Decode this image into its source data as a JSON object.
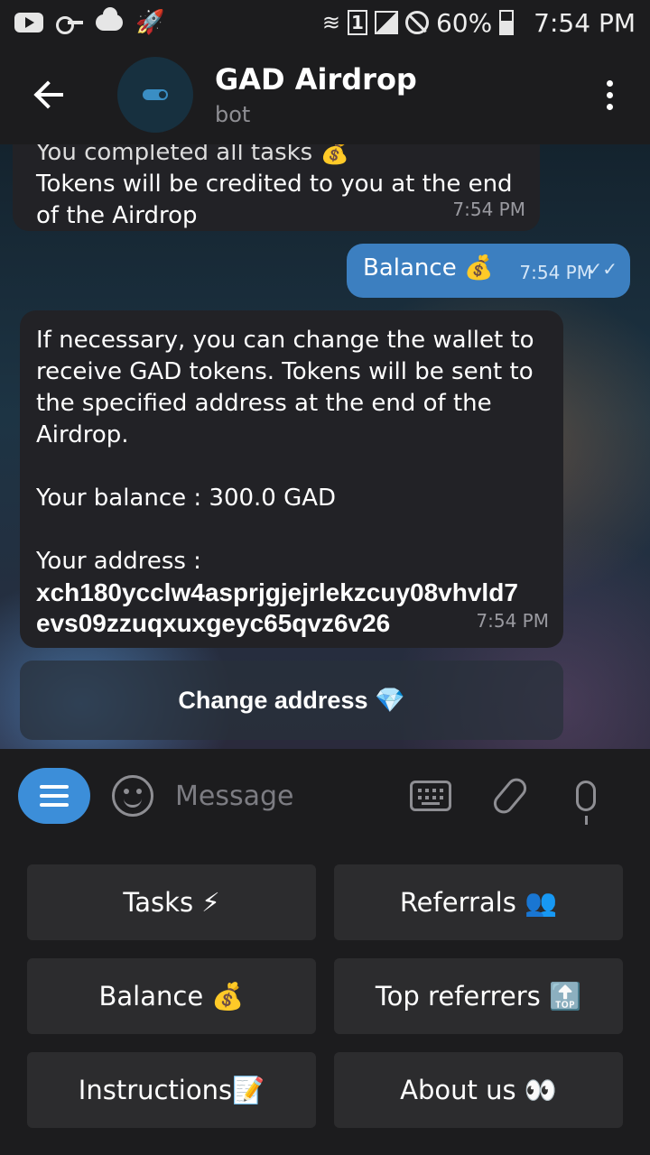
{
  "status_bar": {
    "battery": "60%",
    "time": "7:54 PM",
    "sim_slot": "1",
    "icons": [
      "youtube-icon",
      "key-icon",
      "cloud-icon",
      "rocket-icon",
      "wifi-icon",
      "signal-icon",
      "do-not-disturb-icon",
      "battery-icon"
    ]
  },
  "header": {
    "title": "GAD Airdrop",
    "subtitle": "bot"
  },
  "messages": {
    "m1": {
      "cut_line": "You completed all tasks 💰",
      "text": "Tokens will be credited to you at the end of the Airdrop",
      "time": "7:54 PM"
    },
    "m2": {
      "text": "Balance 💰",
      "time": "7:54 PM",
      "status": "read"
    },
    "m3": {
      "intro": "If necessary, you can change the wallet to receive GAD tokens. Tokens will be sent to the specified address at the end of the Airdrop.",
      "balance": "Your balance : 300.0 GAD",
      "address_label": "Your address :",
      "address_line1": "xch180ycclw4asprjgjejrlekzcuy08vhvld7",
      "address_line2": "evs09zzuqxuxgeyc65qvz6v26",
      "time": "7:54 PM"
    }
  },
  "inline_button": {
    "label": "Change address 💎"
  },
  "input": {
    "placeholder": "Message"
  },
  "keyboard": {
    "tasks": "Tasks ⚡",
    "referrals": "Referrals 👥",
    "balance": "Balance 💰",
    "top_referrers": "Top referrers 🔝",
    "instructions": "Instructions📝",
    "about": "About us 👀"
  },
  "colors": {
    "accent": "#3c8ed9",
    "outgoing_bubble": "#3c7fc0",
    "incoming_bubble": "#222226",
    "background": "#1c1c1e"
  }
}
